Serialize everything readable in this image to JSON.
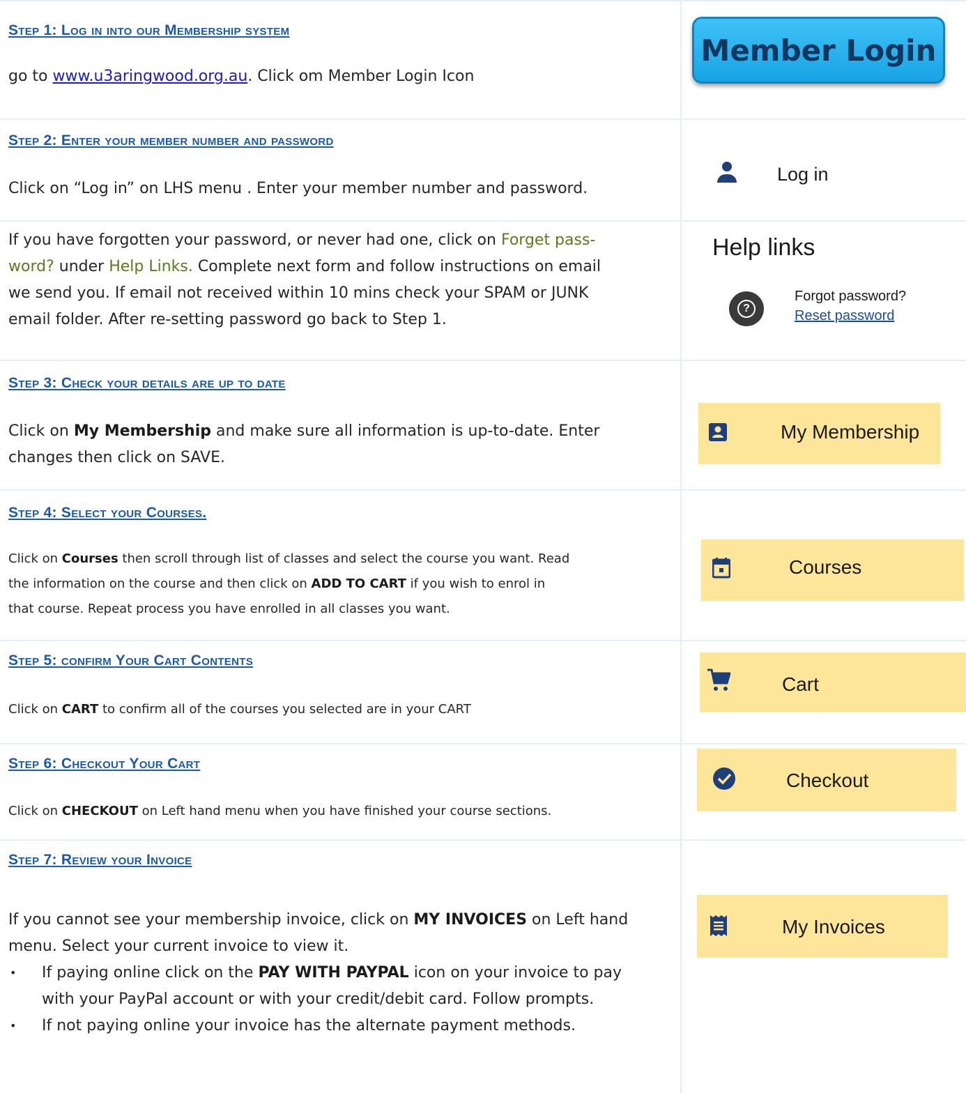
{
  "steps": {
    "s1": {
      "heading": "Step 1: Log in into our Membership system",
      "text_prefix": "go to ",
      "link": "www.u3aringwood.org.au",
      "text_suffix": ". Click om Member Login Icon",
      "button_label": "Member Login"
    },
    "s2": {
      "heading": "Step 2: Enter your member number and password",
      "text": "Click on “Log in”  on LHS menu . Enter your member number and password.",
      "menu_label": "Log in"
    },
    "s2b": {
      "line1_a": "If you have forgotten your password, or never had one, click on ",
      "line1_b": "Forget pass-",
      "line2_a": "word?",
      "line2_b": " under ",
      "line2_c": "Help Links.",
      "line2_d": " Complete next form and follow instructions on email",
      "line3": "we send you. If email not received within 10 mins check your SPAM or JUNK",
      "line4": "email folder. After re-setting password go back to Step 1.",
      "help_title": "Help links",
      "forgot": "Forgot password?",
      "reset": "Reset password"
    },
    "s3": {
      "heading": "Step 3: Check your details are up to date",
      "a": "Click on ",
      "bold": "My Membership",
      "b": " and make sure all information is up-to-date.  Enter",
      "line2": "changes then click on SAVE.",
      "menu_label": "My Membership"
    },
    "s4": {
      "heading": "Step 4: Select your Courses.",
      "a": "Click on ",
      "bold1": "Courses",
      "b": " then scroll through list of classes and select the course you want. Read",
      "line2_a": "the information on the  course and then click on ",
      "bold2": "ADD TO CART",
      "line2_b": " if you wish to enrol in",
      "line3": "that course. Repeat process you have enrolled in all classes you want.",
      "menu_label": "Courses"
    },
    "s5": {
      "heading": "Step 5: confirm Your Cart Contents",
      "a": "Click on ",
      "bold": "CART",
      "b": " to confirm all of the courses you selected are in your CART",
      "menu_label": "Cart"
    },
    "s6": {
      "heading": "Step 6: Checkout Your Cart",
      "a": "Click on ",
      "bold": "CHECKOUT",
      "b": " on Left hand menu when you have finished your course sections.",
      "menu_label": "Checkout"
    },
    "s7": {
      "heading": "Step 7: Review your Invoice",
      "a": "If you cannot see your membership invoice, click on ",
      "bold": "MY INVOICES",
      "b": " on Left hand",
      "line2": "menu. Select your current invoice to view it.",
      "bullet1_a": "If paying online click on the ",
      "bullet1_bold": "PAY WITH PAYPAL",
      "bullet1_b": " icon on your invoice to pay",
      "bullet1_line2": "with your PayPal account or with your credit/debit card. Follow prompts.",
      "bullet2": "If not paying online your invoice has the alternate payment methods.",
      "menu_label": "My Invoices"
    }
  },
  "colors": {
    "heading": "#1a5aa8",
    "menu_highlight": "#fde599",
    "icon_blue": "#1e3f7a",
    "link": "#1c1cc8",
    "olive": "#5c7a1d"
  }
}
